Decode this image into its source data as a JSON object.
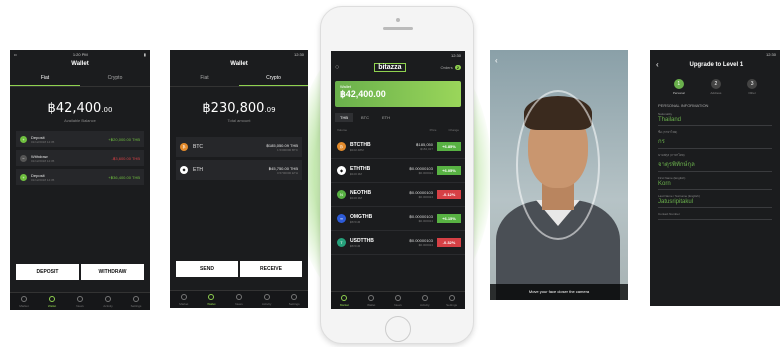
{
  "phone1": {
    "status_time": "1:20 PM",
    "title": "Wallet",
    "tabs": [
      "Fiat",
      "Crypto"
    ],
    "balance": "฿42,400",
    "balance_decimals": ".00",
    "balance_label": "Available Balance",
    "transactions": [
      {
        "name": "Deposit",
        "date": "01/12/2018 14:35",
        "amount": "+฿20,000.00 THB",
        "color": "#6fbf3f",
        "icon": "plus-icon"
      },
      {
        "name": "Withdraw",
        "date": "01/12/2018 14:35",
        "amount": "-฿3,600.00 THB",
        "color": "#d64045",
        "icon": "minus-icon"
      },
      {
        "name": "Deposit",
        "date": "01/12/2018 14:35",
        "amount": "+฿36,400.00 THB",
        "color": "#6fbf3f",
        "icon": "plus-icon"
      }
    ],
    "deposit": "DEPOSIT",
    "withdraw": "WITHDRAW",
    "nav": [
      "Market",
      "Wallet",
      "News",
      "Activity",
      "Settings"
    ]
  },
  "phone2": {
    "status_time": "12:30",
    "title": "Wallet",
    "tabs": [
      "Fiat",
      "Crypto"
    ],
    "balance": "฿230,800",
    "balance_decimals": ".09",
    "balance_label": "Total amount",
    "coins": [
      {
        "name": "BTC",
        "value": "฿185,050.09 THB",
        "sub": "1.5300000 BTC",
        "color": "#e38b2c",
        "icon": "bitcoin-icon"
      },
      {
        "name": "ETH",
        "value": "฿45,750.00 THB",
        "sub": "0.5700000 ETH",
        "color": "#ffffff",
        "icon": "ethereum-icon"
      }
    ],
    "send": "SEND",
    "receive": "RECEIVE",
    "nav": [
      "Market",
      "Wallet",
      "News",
      "Activity",
      "Settings"
    ]
  },
  "center": {
    "status_time": "12:30",
    "logo": "bitazza",
    "orders_label": "Orders",
    "orders_count": "2",
    "wallet_label": "Wallet",
    "wallet_value": "฿42,400.00",
    "tabs": [
      "THB",
      "BTC",
      "ETH"
    ],
    "columns": [
      "Volume",
      "Price",
      "Change"
    ],
    "rows": [
      {
        "pair": "BTCTHB",
        "vol": "฿102.48M",
        "price": "฿185,050",
        "price_sub": "฿182,027",
        "change": "+6.85%",
        "dir": "up",
        "icon": "bitcoin-icon"
      },
      {
        "pair": "ETHTHB",
        "vol": "฿100.9M",
        "price": "฿0.00000103",
        "price_sub": "฿0.000024",
        "change": "+6.05%",
        "dir": "up",
        "icon": "ethereum-icon"
      },
      {
        "pair": "NEOTHB",
        "vol": "฿100.9M",
        "price": "฿0.00000103",
        "price_sub": "฿0.000024",
        "change": "-0.12%",
        "dir": "down",
        "icon": "neo-icon"
      },
      {
        "pair": "OMGTHB",
        "vol": "฿8.51M",
        "price": "฿0.00000103",
        "price_sub": "฿0.000024",
        "change": "+6.15%",
        "dir": "up",
        "icon": "omisego-icon"
      },
      {
        "pair": "USDTTHB",
        "vol": "฿8.51M",
        "price": "฿0.00000103",
        "price_sub": "฿0.000024",
        "change": "-0.32%",
        "dir": "down",
        "icon": "tether-icon"
      }
    ],
    "nav": [
      "Market",
      "Wallet",
      "News",
      "Activity",
      "Settings"
    ]
  },
  "face": {
    "caption": "Move your face closer the camera"
  },
  "kyc": {
    "status_time": "12:30",
    "title": "Upgrade to Level 1",
    "steps": [
      {
        "n": "1",
        "label": "Personal"
      },
      {
        "n": "2",
        "label": "Address"
      },
      {
        "n": "3",
        "label": "Other"
      }
    ],
    "section": "PERSONAL INFORMATION",
    "fields": [
      {
        "label": "Nationality",
        "value": "Thailand"
      },
      {
        "label": "ชื่อ (ภาษาไทย)",
        "value": "กร"
      },
      {
        "label": "นามสกุล (ภาษาไทย)",
        "value": "จาตุรพิทักษ์กุล"
      },
      {
        "label": "First Name (English)",
        "value": "Korn"
      },
      {
        "label": "Last Name / Surname (English)",
        "value": "Jatusripitakul"
      },
      {
        "label": "Contact Number",
        "value": ""
      }
    ]
  }
}
